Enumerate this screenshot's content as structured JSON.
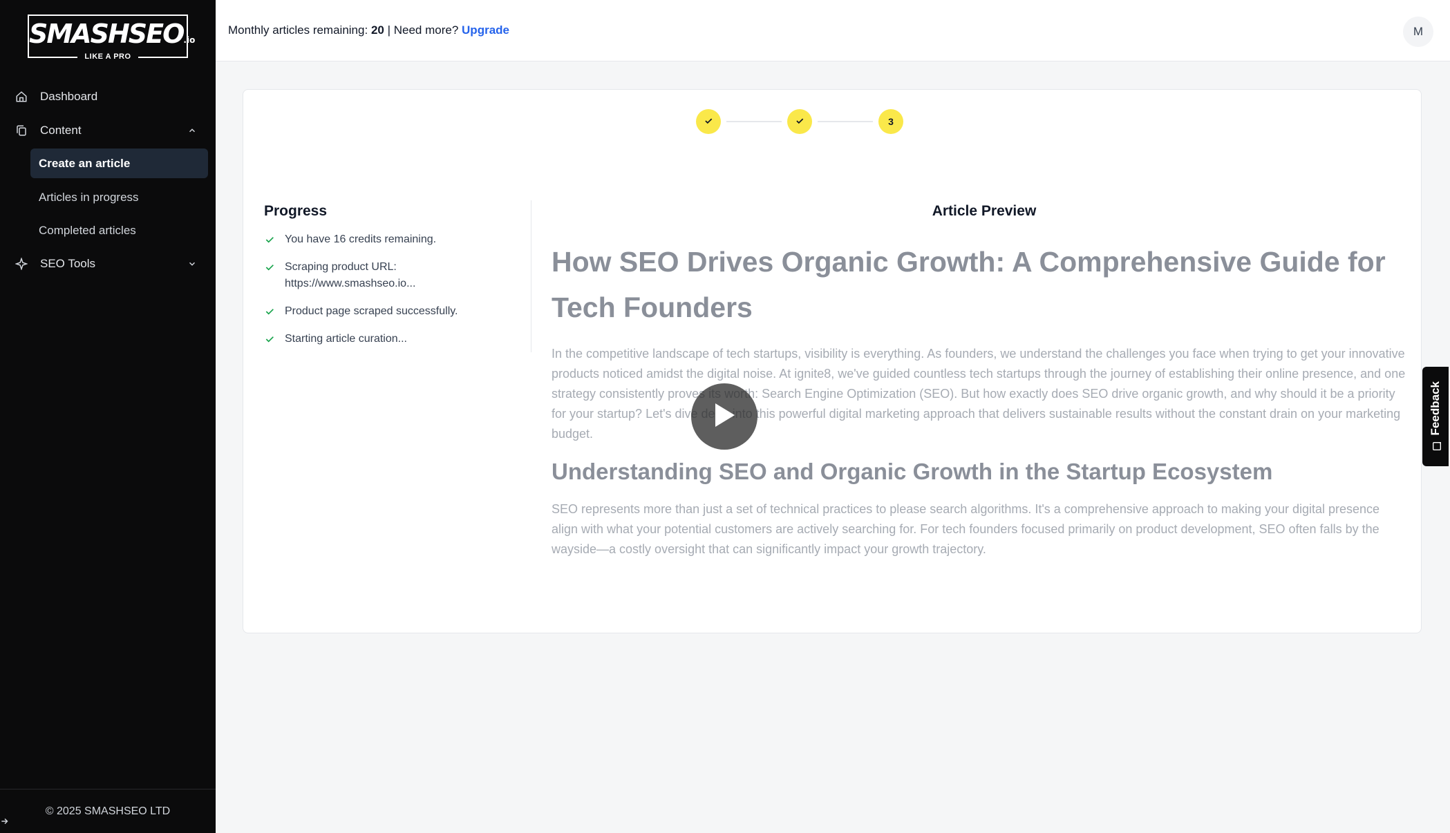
{
  "brand": {
    "name": "SMASHSEO",
    "suffix": ".io",
    "tagline": "LIKE A PRO"
  },
  "sidebar": {
    "items": [
      {
        "label": "Dashboard",
        "icon": "home-icon"
      },
      {
        "label": "Content",
        "icon": "copy-icon",
        "expanded": true
      },
      {
        "label": "SEO Tools",
        "icon": "sparkle-icon",
        "expanded": false
      }
    ],
    "content_subitems": [
      {
        "label": "Create an article",
        "active": true
      },
      {
        "label": "Articles in progress",
        "active": false
      },
      {
        "label": "Completed articles",
        "active": false
      }
    ],
    "footer": "© 2025 SMASHSEO LTD"
  },
  "topbar": {
    "credits_prefix": "Monthly articles remaining:",
    "credits_count": "20",
    "credits_suffix": "| Need more?",
    "upgrade_label": "Upgrade",
    "avatar_initial": "M"
  },
  "stepper": {
    "steps": [
      {
        "state": "done",
        "icon": "check-icon"
      },
      {
        "state": "done",
        "icon": "check-icon"
      },
      {
        "state": "current",
        "label": "3"
      }
    ]
  },
  "progress": {
    "title": "Progress",
    "items": [
      {
        "line1": "You have 16 credits remaining.",
        "line2": ""
      },
      {
        "line1": "Scraping product URL:",
        "line2": "https://www.smashseo.io..."
      },
      {
        "line1": "Product page scraped successfully.",
        "line2": ""
      },
      {
        "line1": "Starting article curation...",
        "line2": ""
      }
    ]
  },
  "preview": {
    "title": "Article Preview",
    "h1": "How SEO Drives Organic Growth: A Comprehensive Guide for Tech Founders",
    "p1": "In the competitive landscape of tech startups, visibility is everything. As founders, we understand the challenges you face when trying to get your innovative products noticed amidst the digital noise. At ignite8, we've guided countless tech startups through the journey of establishing their online presence, and one strategy consistently proves its worth: Search Engine Optimization (SEO). But how exactly does SEO drive organic growth, and why should it be a priority for your startup? Let's dive deep into this powerful digital marketing approach that delivers sustainable results without the constant drain on your marketing budget.",
    "h2": "Understanding SEO and Organic Growth in the Startup Ecosystem",
    "p2": "SEO represents more than just a set of technical practices to please search algorithms. It's a comprehensive approach to making your digital presence align with what your potential customers are actively searching for. For tech founders focused primarily on product development, SEO often falls by the wayside—a costly oversight that can significantly impact your growth trajectory."
  },
  "feedback_label": "Feedback",
  "colors": {
    "sidebar_bg": "#0b0b0c",
    "step_accent": "#fae84a",
    "link": "#2563eb",
    "check_green": "#16a34a"
  }
}
